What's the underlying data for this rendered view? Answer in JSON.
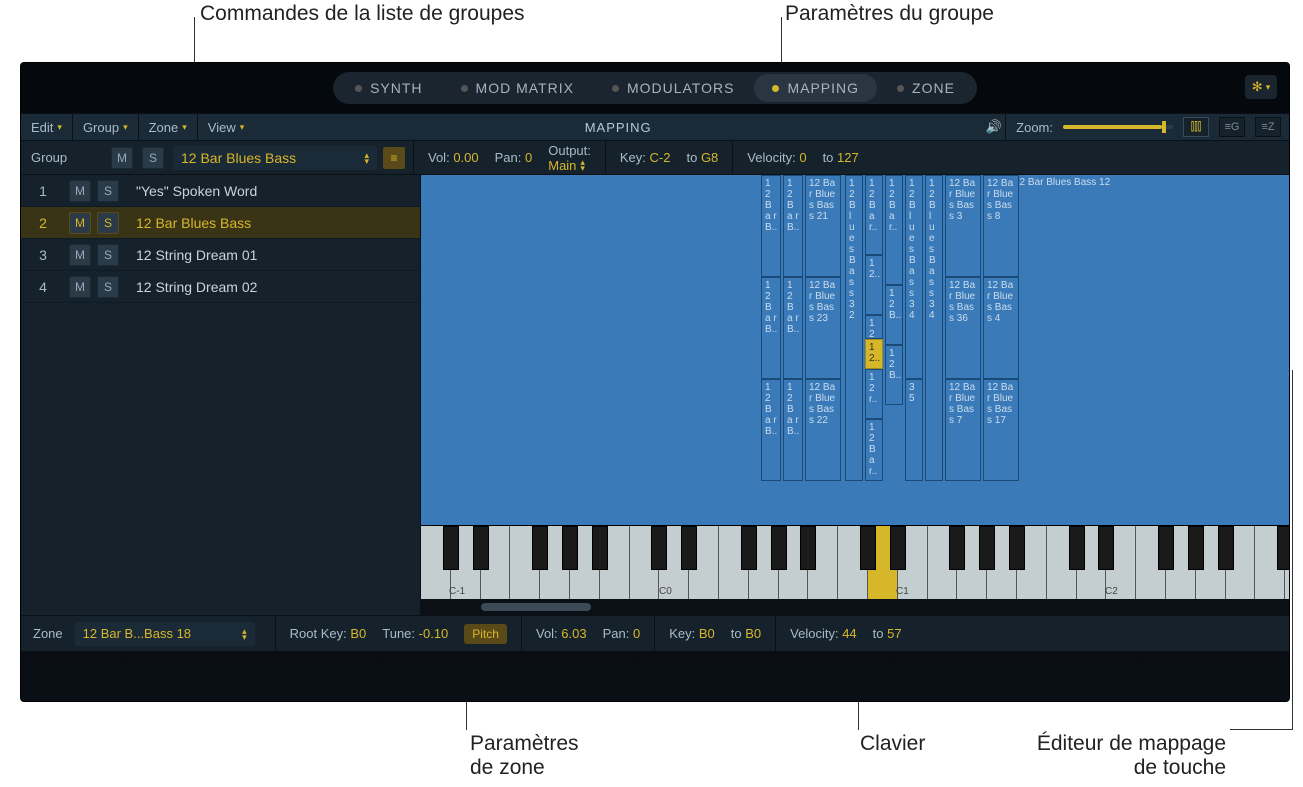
{
  "callouts": {
    "group_list_cmds": "Commandes de la liste de groupes",
    "group_params": "Paramètres du groupe",
    "zone_params_l1": "Paramètres",
    "zone_params_l2": "de zone",
    "keyboard": "Clavier",
    "keymap_l1": "Éditeur de mappage",
    "keymap_l2": "de touche"
  },
  "tabs": {
    "synth": "SYNTH",
    "mod_matrix": "MOD MATRIX",
    "modulators": "MODULATORS",
    "mapping": "MAPPING",
    "zone": "ZONE"
  },
  "menubar": {
    "edit": "Edit",
    "group": "Group",
    "zone": "Zone",
    "view": "View",
    "title": "MAPPING",
    "zoom_label": "Zoom:"
  },
  "group_header": {
    "label": "Group",
    "m": "M",
    "s": "S",
    "name": "12 Bar Blues Bass",
    "vol_l": "Vol:",
    "vol_v": "0.00",
    "pan_l": "Pan:",
    "pan_v": "0",
    "out_l": "Output:",
    "out_v": "Main",
    "key_l": "Key:",
    "key_from": "C-2",
    "to": "to",
    "key_to": "G8",
    "vel_l": "Velocity:",
    "vel_from": "0",
    "vel_to": "127"
  },
  "groups": [
    {
      "n": "1",
      "name": "\"Yes\" Spoken Word",
      "sel": false
    },
    {
      "n": "2",
      "name": "12 Bar Blues Bass",
      "sel": true
    },
    {
      "n": "3",
      "name": "12 String Dream 01",
      "sel": false
    },
    {
      "n": "4",
      "name": "12 String Dream 02",
      "sel": false
    }
  ],
  "zone_labels": {
    "big": "12 Bar Blues Bass 12",
    "c1a": "1 2 B a r B..",
    "c1b": "1 2 B a r B..",
    "c1c": "1 2 B a r B..",
    "c2a": "1 2 B a r B..",
    "c2b": "1 2 B a r B..",
    "c2c": "1 2 B a r B..",
    "c3a": "12 Bar Blues Bass 21",
    "c3b": "12 Bar Blues Bass 23",
    "c3c": "12 Bar Blues Bass 22",
    "c4": "1 2 B l u e s B a s s 3 2",
    "c5a": "1 2 B a r..",
    "c5b": "1 2..",
    "c5c": "1 2 r..",
    "c5d": "1 2 r..",
    "c5e": "1 2 B a r..",
    "c6a": "1 2 B a r..",
    "c6b": "1 2 B..",
    "c6c": "1 2 B..",
    "c7a": "1 2 B l u e s B a s s 3 4",
    "c7b": "3 5",
    "c8a": "12 Bar Blues Bass 3",
    "c8b": "12 Bar Blues Bass 36",
    "c8c": "12 Bar Blues Bass 7",
    "c9a": "12 Bar Blues Bass 8",
    "c9b": "12 Bar Blues Bass 4",
    "c9c": "12 Bar Blues Bass 17"
  },
  "kbd_labels": {
    "cm1": "C-1",
    "c0": "C0",
    "c1": "C1",
    "c2": "C2"
  },
  "zone_footer": {
    "label": "Zone",
    "name": "12 Bar B...Bass 18",
    "root_l": "Root Key:",
    "root_v": "B0",
    "tune_l": "Tune:",
    "tune_v": "-0.10",
    "pitch": "Pitch",
    "vol_l": "Vol:",
    "vol_v": "6.03",
    "pan_l": "Pan:",
    "pan_v": "0",
    "key_l": "Key:",
    "key_from": "B0",
    "to": "to",
    "key_to": "B0",
    "vel_l": "Velocity:",
    "vel_from": "44",
    "vel_to": "57"
  }
}
